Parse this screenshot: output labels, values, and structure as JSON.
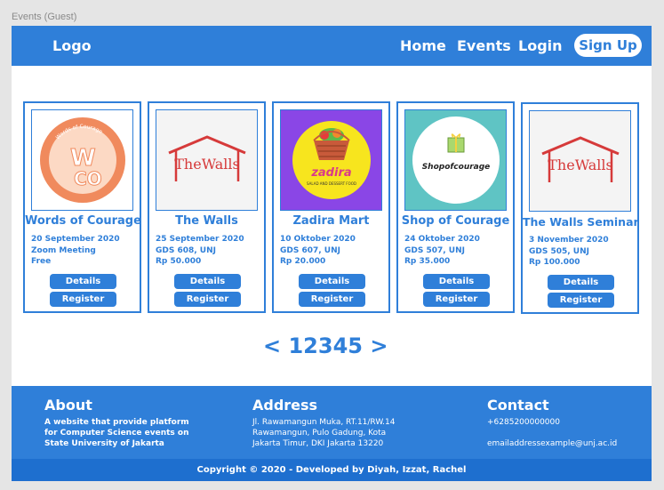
{
  "window": {
    "title": "Events (Guest)"
  },
  "nav": {
    "logo": "Logo",
    "home": "Home",
    "events": "Events",
    "login": "Login",
    "signup": "Sign Up"
  },
  "events": [
    {
      "title": "Words of Courage",
      "date": "20 September 2020",
      "location": "Zoom Meeting",
      "price": "Free",
      "logo_text": "Words of Courage",
      "details": "Details",
      "register": "Register"
    },
    {
      "title": "The Walls",
      "date": "25 September 2020",
      "location": "GDS 608, UNJ",
      "price": "Rp 50.000",
      "logo_text": "TheWalls",
      "details": "Details",
      "register": "Register"
    },
    {
      "title": "Zadira Mart",
      "date": "10 Oktober 2020",
      "location": "GDS 607, UNJ",
      "price": "Rp 20.000",
      "logo_text": "zadira",
      "logo_sub": "SALAD AND DESSERT FOOD",
      "details": "Details",
      "register": "Register"
    },
    {
      "title": "Shop of Courage",
      "date": "24 Oktober 2020",
      "location": "GDS 507, UNJ",
      "price": "Rp 35.000",
      "logo_text": "Shopofcourage",
      "details": "Details",
      "register": "Register"
    },
    {
      "title": "The Walls Seminar",
      "date": "3 November 2020",
      "location": "GDS 505, UNJ",
      "price": "Rp 100.000",
      "logo_text": "TheWalls",
      "details": "Details",
      "register": "Register"
    }
  ],
  "pagination": {
    "prev": "<",
    "pages": [
      "1",
      "2",
      "3",
      "4",
      "5"
    ],
    "next": ">"
  },
  "footer": {
    "about": {
      "heading": "About",
      "lines": [
        "A website that provide platform",
        "for Computer Science events on",
        "State University of Jakarta"
      ]
    },
    "address": {
      "heading": "Address",
      "lines": [
        "Jl. Rawamangun Muka, RT.11/RW.14",
        "Rawamangun, Pulo Gadung, Kota",
        "Jakarta Timur, DKI Jakarta 13220"
      ]
    },
    "contact": {
      "heading": "Contact",
      "phone": "+6285200000000",
      "email": "emailaddressexample@unj.ac.id"
    },
    "copyright": "Copyright © 2020 - Developed by Diyah, Izzat, Rachel"
  },
  "colors": {
    "primary": "#2f7fd9",
    "footer_bar": "#1e6fcf"
  }
}
